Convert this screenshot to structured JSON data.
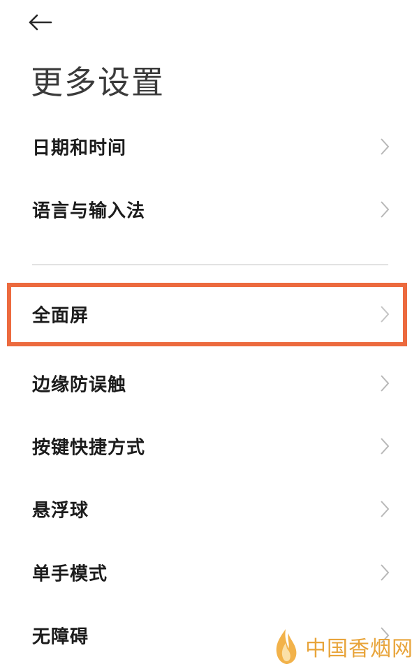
{
  "header": {
    "back_icon": "arrow-left-icon",
    "title": "更多设置"
  },
  "settings": {
    "group1": [
      {
        "label": "日期和时间"
      },
      {
        "label": "语言与输入法"
      }
    ],
    "group2": [
      {
        "label": "全面屏",
        "highlighted": true
      },
      {
        "label": "边缘防误触"
      },
      {
        "label": "按键快捷方式"
      },
      {
        "label": "悬浮球"
      },
      {
        "label": "单手模式"
      },
      {
        "label": "无障碍"
      }
    ]
  },
  "highlight_color": "#ec6a3e",
  "watermark": {
    "icon": "flame-logo-icon",
    "text": "中国香烟网",
    "color": "#e8a43a"
  }
}
